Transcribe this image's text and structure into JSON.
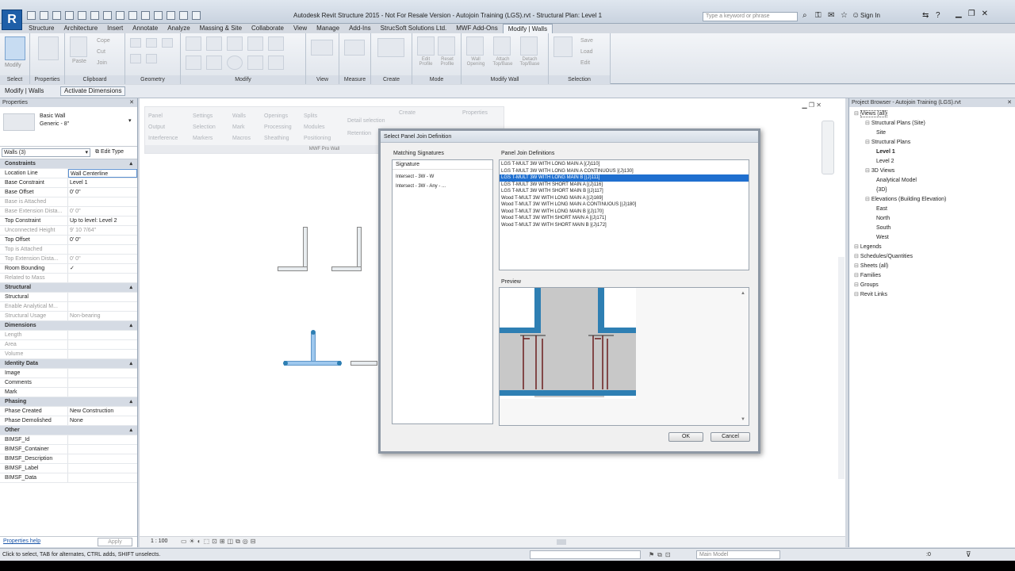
{
  "app": {
    "logo": "R",
    "title": "Autodesk Revit Structure 2015 - Not For Resale Version -  Autojoin Training (LGS).rvt - Structural Plan: Level 1",
    "search_placeholder": "Type a keyword or phrase",
    "sign_in": "Sign In"
  },
  "ribbon_tabs": [
    "Structure",
    "Architecture",
    "Insert",
    "Annotate",
    "Analyze",
    "Massing & Site",
    "Collaborate",
    "View",
    "Manage",
    "Add-Ins",
    "StrucSoft Solutions Ltd.",
    "MWF Add-Ons",
    "Modify | Walls"
  ],
  "ribbon_panels": [
    {
      "label": "Select",
      "items": [
        "Modify"
      ]
    },
    {
      "label": "Properties",
      "items": []
    },
    {
      "label": "Clipboard",
      "items": [
        "Paste",
        "Cope",
        "Cut",
        "Join"
      ]
    },
    {
      "label": "Geometry",
      "items": []
    },
    {
      "label": "Modify",
      "items": []
    },
    {
      "label": "View",
      "items": []
    },
    {
      "label": "Measure",
      "items": []
    },
    {
      "label": "Create",
      "items": []
    },
    {
      "label": "Mode",
      "items": [
        "Edit Profile",
        "Reset Profile"
      ]
    },
    {
      "label": "Modify Wall",
      "items": [
        "Wall Opening",
        "Attach Top/Base",
        "Detach Top/Base",
        "Edit"
      ]
    },
    {
      "label": "Selection",
      "items": [
        "Save",
        "Load",
        "Edit"
      ]
    }
  ],
  "options_bar": {
    "context": "Modify | Walls",
    "button": "Activate Dimensions"
  },
  "properties": {
    "header": "Properties",
    "type_name": "Basic Wall",
    "type_sub": "Generic - 8\"",
    "selector": "Walls (3)",
    "edit_type": "Edit Type",
    "rows": [
      {
        "k": "Constraints",
        "v": "",
        "section": true
      },
      {
        "k": "Location Line",
        "v": "Wall Centerline"
      },
      {
        "k": "Base Constraint",
        "v": "Level 1"
      },
      {
        "k": "Base Offset",
        "v": "0' 0\""
      },
      {
        "k": "Base is Attached",
        "v": "",
        "dim": true
      },
      {
        "k": "Base Extension Dista...",
        "v": "0' 0\"",
        "dim": true
      },
      {
        "k": "Top Constraint",
        "v": "Up to level: Level 2"
      },
      {
        "k": "Unconnected Height",
        "v": "9' 10 7/64\"",
        "dim": true
      },
      {
        "k": "Top Offset",
        "v": "0' 0\""
      },
      {
        "k": "Top is Attached",
        "v": "",
        "dim": true
      },
      {
        "k": "Top Extension Dista...",
        "v": "0' 0\"",
        "dim": true
      },
      {
        "k": "Room Bounding",
        "v": "✓"
      },
      {
        "k": "Related to Mass",
        "v": "",
        "dim": true
      },
      {
        "k": "Structural",
        "v": "",
        "section": true
      },
      {
        "k": "Structural",
        "v": ""
      },
      {
        "k": "Enable Analytical M...",
        "v": "",
        "dim": true
      },
      {
        "k": "Structural Usage",
        "v": "Non-bearing",
        "dim": true
      },
      {
        "k": "Dimensions",
        "v": "",
        "section": true
      },
      {
        "k": "Length",
        "v": "",
        "dim": true
      },
      {
        "k": "Area",
        "v": "",
        "dim": true
      },
      {
        "k": "Volume",
        "v": "",
        "dim": true
      },
      {
        "k": "Identity Data",
        "v": "",
        "section": true
      },
      {
        "k": "Image",
        "v": ""
      },
      {
        "k": "Comments",
        "v": ""
      },
      {
        "k": "Mark",
        "v": ""
      },
      {
        "k": "Phasing",
        "v": "",
        "section": true
      },
      {
        "k": "Phase Created",
        "v": "New Construction"
      },
      {
        "k": "Phase Demolished",
        "v": "None"
      },
      {
        "k": "Other",
        "v": "",
        "section": true
      },
      {
        "k": "BIMSF_Id",
        "v": ""
      },
      {
        "k": "BIMSF_Container",
        "v": ""
      },
      {
        "k": "BIMSF_Description",
        "v": ""
      },
      {
        "k": "BIMSF_Label",
        "v": ""
      },
      {
        "k": "BIMSF_Data",
        "v": ""
      }
    ],
    "help": "Properties help",
    "apply": "Apply"
  },
  "mwf_panel": {
    "items": [
      "Panel",
      "Settings",
      "Walls",
      "Openings",
      "Splits",
      "Output",
      "Selection",
      "Mark",
      "Processing",
      "Modules",
      "Interference",
      "Markers",
      "Macros",
      "Sheathing",
      "Positioning",
      "Create",
      "Properties",
      "Detail selection",
      "Retention"
    ],
    "label": "MWF Pro Wall"
  },
  "dialog": {
    "title": "Select Panel Join Definition",
    "matching_label": "Matching Signatures",
    "signature_header": "Signature",
    "signatures": [
      "Intersect - 3W - W",
      "Intersect - 3W - Any - ..."
    ],
    "definitions_label": "Panel Join Definitions",
    "definitions": [
      "LGS T-MULT 3W WITH LONG MAIN A [(J)110]",
      "LGS T-MULT 3W WITH LONG MAIN A CONTINUOUS [(J)130]",
      "LGS T-MULT 3W WITH LONG MAIN B [(J)111]",
      "LGS T-MULT 3W WITH SHORT MAIN A [(J)116]",
      "LGS T-MULT 3W WITH SHORT MAIN B [(J)117]",
      "Wood T-MULT 3W WITH LONG MAIN A [(J)169]",
      "Wood T-MULT 3W WITH LONG MAIN A CONTINUOUS [(J)180]",
      "Wood T-MULT 3W WITH LONG MAIN B [(J)170]",
      "Wood T-MULT 3W WITH SHORT MAIN A [(J)171]",
      "Wood T-MULT 3W WITH SHORT MAIN B [(J)172]"
    ],
    "selected_index": 2,
    "preview_label": "Preview",
    "ok": "OK",
    "cancel": "Cancel"
  },
  "project_browser": {
    "title": "Project Browser - Autojoin Training (LGS).rvt",
    "tree": [
      {
        "t": "Views (all)",
        "d": 0,
        "sel": true
      },
      {
        "t": "Structural Plans (Site)",
        "d": 1
      },
      {
        "t": "Site",
        "d": 2
      },
      {
        "t": "Structural Plans",
        "d": 1
      },
      {
        "t": "Level 1",
        "d": 2,
        "bold": true
      },
      {
        "t": "Level 2",
        "d": 2
      },
      {
        "t": "3D Views",
        "d": 1
      },
      {
        "t": "Analytical Model",
        "d": 2
      },
      {
        "t": "{3D}",
        "d": 2
      },
      {
        "t": "Elevations (Building Elevation)",
        "d": 1
      },
      {
        "t": "East",
        "d": 2
      },
      {
        "t": "North",
        "d": 2
      },
      {
        "t": "South",
        "d": 2
      },
      {
        "t": "West",
        "d": 2
      },
      {
        "t": "Legends",
        "d": 0
      },
      {
        "t": "Schedules/Quantities",
        "d": 0
      },
      {
        "t": "Sheets (all)",
        "d": 0
      },
      {
        "t": "Families",
        "d": 0
      },
      {
        "t": "Groups",
        "d": 0
      },
      {
        "t": "Revit Links",
        "d": 0
      }
    ]
  },
  "view_control": {
    "scale": "1 : 100"
  },
  "status": {
    "text": "Click to select, TAB for alternates, CTRL adds, SHIFT unselects.",
    "model": "Main Model",
    "count": ":0"
  },
  "colors": {
    "accent": "#1f6fcf",
    "steel": "#2e7fb3",
    "wall_blue": "#9ec8ee"
  }
}
